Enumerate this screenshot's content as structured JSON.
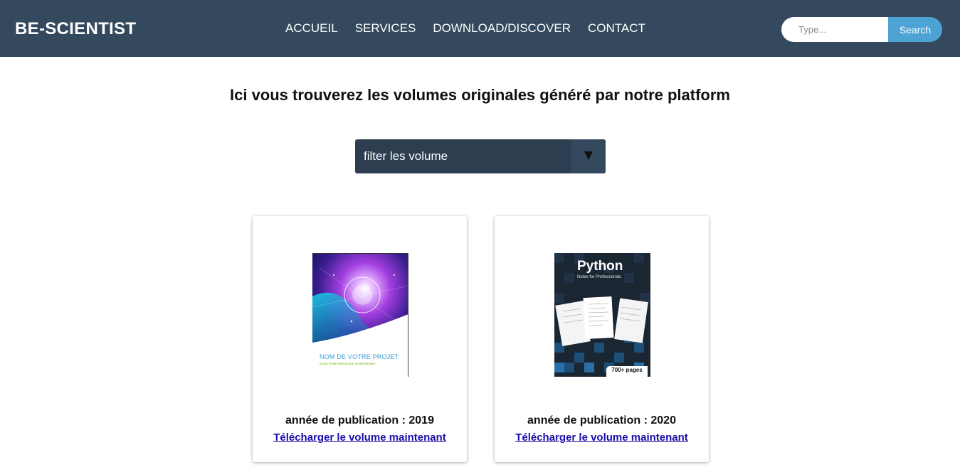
{
  "navbar": {
    "brand": "BE-SCIENTIST",
    "links": [
      "ACCUEIL",
      "SERVICES",
      "DOWNLOAD/DISCOVER",
      "CONTACT"
    ],
    "search": {
      "placeholder": "Type...",
      "button_label": "Search"
    }
  },
  "main": {
    "title": "Ici vous trouverez les volumes originales généré par notre platform",
    "filter": {
      "selected": "filter les volume"
    }
  },
  "volumes": [
    {
      "year_text": "année de publication : 2019",
      "link_label": "Télécharger le volume maintenant",
      "cover": {
        "title": "NOM DE VOTRE PROJET",
        "subtitle": "SOUS-TITRE EXPLICATIF LE DÉCRIVANT"
      }
    },
    {
      "year_text": "année de publication : 2020",
      "link_label": "Télécharger le volume maintenant",
      "cover": {
        "title": "Python",
        "subtitle": "Notes for Professionals",
        "badge": "700+ pages"
      }
    }
  ],
  "colors": {
    "navbar": "#34495e",
    "filter_bg": "#2c3e50",
    "search_button": "#4da3d4",
    "link": "#1a0dab"
  },
  "icons": {
    "filter_arrow": "triangle-down-icon"
  }
}
